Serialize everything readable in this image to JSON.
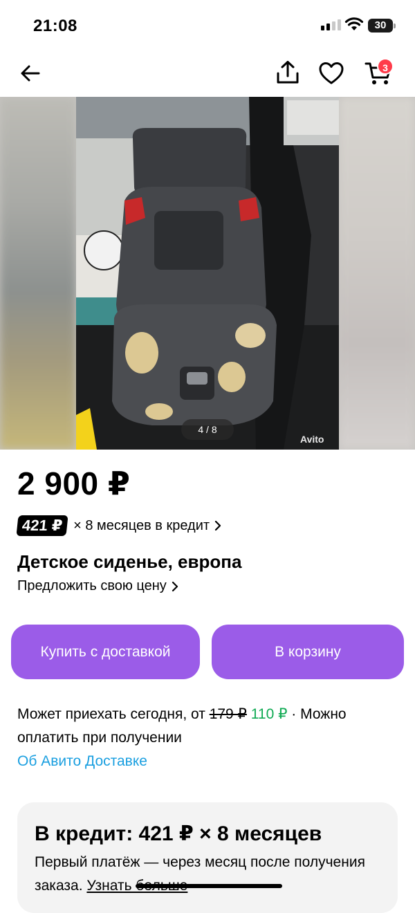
{
  "status_bar": {
    "time": "21:08",
    "battery": "30"
  },
  "nav": {
    "cart_badge": "3",
    "icons": [
      "back-arrow-icon",
      "share-icon",
      "heart-icon",
      "cart-icon"
    ]
  },
  "gallery": {
    "counter": "4 / 8",
    "watermark": "Avito"
  },
  "listing": {
    "price": "2 900 ₽",
    "credit_tag": "421 ₽",
    "credit_text": "× 8 месяцев в кредит",
    "title": "Детское сиденье, европа",
    "offer_price": "Предложить свою цену"
  },
  "buttons": {
    "buy_delivery": "Купить с доставкой",
    "add_to_cart": "В корзину"
  },
  "delivery": {
    "prefix": "Может приехать сегодня, от ",
    "old_price": "179 ₽",
    "new_price": "110 ₽",
    "suffix": " · Можно оплатить при получении",
    "link": "Об Авито Доставке"
  },
  "credit_card": {
    "title": "В кредит: 421 ₽ × 8 месяцев",
    "subtitle": "Первый платёж — через месяц после получения заказа.",
    "more": "Узнать больше"
  },
  "colors": {
    "accent": "#9b5ce8",
    "green": "#0faa53",
    "link": "#1a9fe0",
    "badge": "#ff3b4a"
  }
}
